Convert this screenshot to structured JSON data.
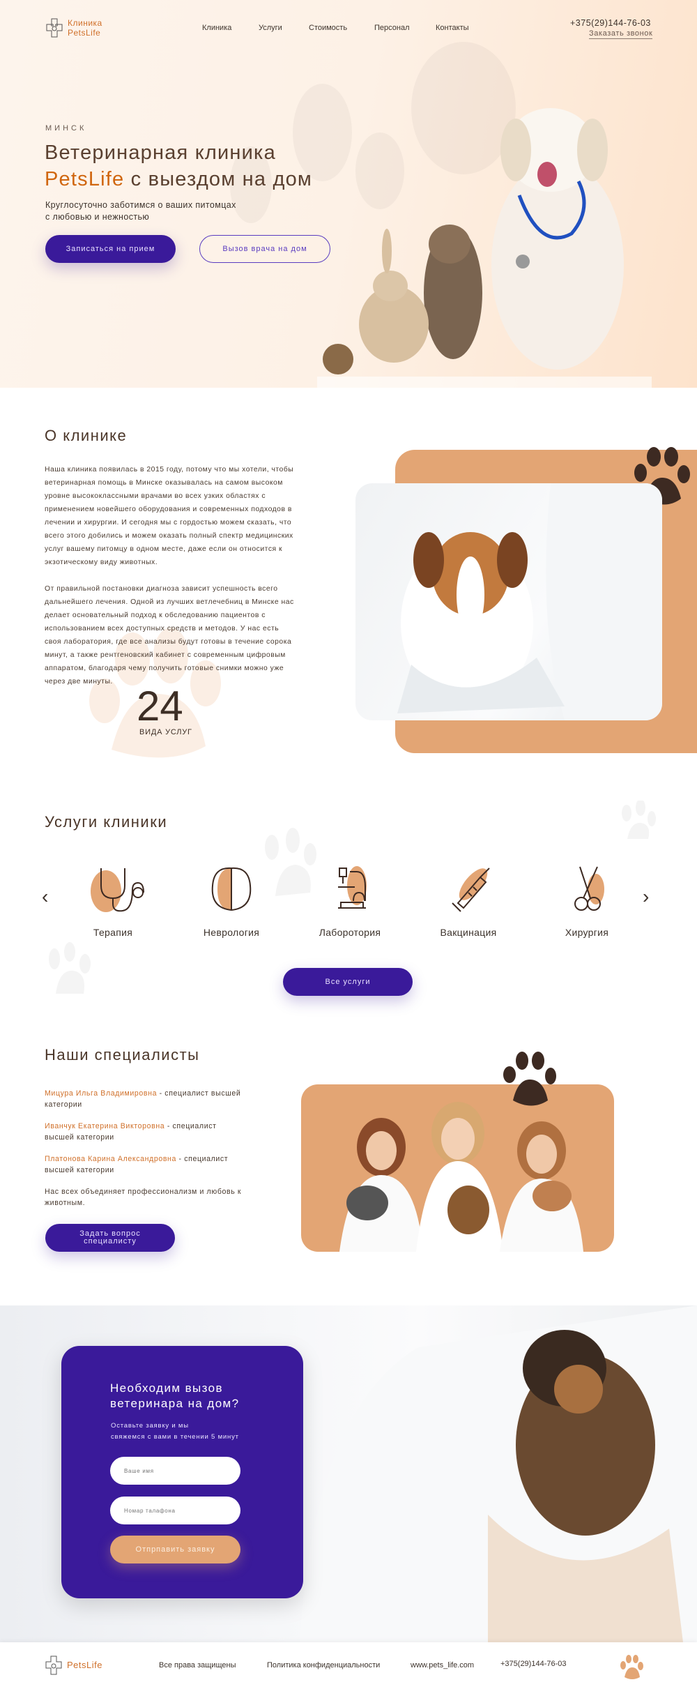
{
  "header": {
    "logo_line1": "Клиника",
    "logo_line2": "PetsLife",
    "nav": [
      "Клиника",
      "Услуги",
      "Стоимость",
      "Персонал",
      "Контакты"
    ],
    "phone": "+375(29)144-76-03",
    "callback": "Заказать звонок"
  },
  "hero": {
    "city": "МИНСК",
    "title_line1": "Ветеринарная клиника",
    "title_accent": "PetsLife",
    "title_rest": "с выездом на дом",
    "subtitle_line1": "Круглосуточно заботимся о ваших питомцах",
    "subtitle_line2": "с любовью и нежностью",
    "btn_primary": "Записаться на прием",
    "btn_secondary": "Вызов врача на дом"
  },
  "about": {
    "title": "О клинике",
    "para1": "Наша клиника появилась в 2015 году, потому что мы хотели, чтобы ветеринарная помощь в Минске оказывалась на самом высоком уровне высококлассными врачами во всех узких областях с применением новейшего оборудования и современных подходов в лечении и хирургии. И сегодня мы с гордостью можем сказать, что всего этого добились и можем оказать полный спектр медицинских услуг вашему питомцу в одном месте, даже если он относится к экзотическому виду животных.",
    "para2": "От правильной постановки диагноза зависит успешность всего дальнейшего лечения. Одной из лучших ветлечебниц в Минске нас делает основательный подход к обследованию пациентов с использованием всех доступных средств и методов. У нас есть своя лаборатория, где все анализы будут готовы в течение сорока минут, а также рентгеновский кабинет с современным цифровым аппаратом, благодаря чему получить готовые снимки можно уже через две минуты.",
    "stat_number": "24",
    "stat_label": "ВИДА УСЛУГ"
  },
  "services": {
    "title": "Услуги клиники",
    "items": [
      {
        "label": "Терапия",
        "icon": "stethoscope-icon"
      },
      {
        "label": "Неврология",
        "icon": "brain-icon"
      },
      {
        "label": "Лаборотория",
        "icon": "microscope-icon"
      },
      {
        "label": "Вакцинация",
        "icon": "syringe-icon"
      },
      {
        "label": "Хирургия",
        "icon": "scissors-icon"
      }
    ],
    "all_button": "Все услуги"
  },
  "specialists": {
    "title": "Наши специалисты",
    "items": [
      {
        "name": "Мицура Ильга Владимировна",
        "role": " - специалист высшей категории"
      },
      {
        "name": "Иванчук Екатерина Викторовна",
        "role": " - специалист высшей категории"
      },
      {
        "name": "Платонова Карина Александровна",
        "role": " - специалист высшей категории"
      }
    ],
    "note": "Нас всех объединяет профессионализм и любовь к животным.",
    "ask_button_line1": "Задать вопрос",
    "ask_button_line2": "специалисту"
  },
  "cta": {
    "title_line1": "Необходим вызов",
    "title_line2": "ветеринара на дом?",
    "text_line1": "Оставьте заявку и мы",
    "text_line2": "свяжемся с вами в течении 5 минут",
    "name_placeholder": "Ваше имя",
    "phone_placeholder": "Номар талафона",
    "submit": "Отпрпавить заявку"
  },
  "footer": {
    "logo": "PetsLife",
    "rights": "Все права защищены",
    "privacy": "Политика конфиденциальности",
    "site": "www.pets_life.com",
    "phone": "+375(29)144-76-03"
  },
  "colors": {
    "purple": "#3a1a9a",
    "orange": "#e3a574",
    "accent": "#d0660f",
    "brown": "#4a3528"
  }
}
